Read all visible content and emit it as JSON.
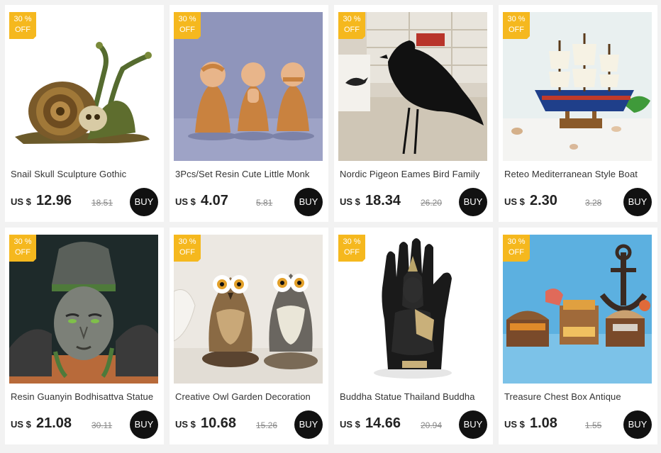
{
  "products": [
    {
      "title": "Snail Skull Sculpture Gothic",
      "currency": "US $",
      "price": "12.96",
      "old_price": "18.51",
      "discount_top": "30 %",
      "discount_bottom": "OFF",
      "buy_label": "BUY",
      "image_icon": "snail-skull-sculpture-icon"
    },
    {
      "title": "3Pcs/Set Resin Cute Little Monk",
      "currency": "US $",
      "price": "4.07",
      "old_price": "5.81",
      "discount_top": "30 %",
      "discount_bottom": "OFF",
      "buy_label": "BUY",
      "image_icon": "monk-figurines-icon"
    },
    {
      "title": "Nordic Pigeon Eames Bird Family",
      "currency": "US $",
      "price": "18.34",
      "old_price": "26.20",
      "discount_top": "30 %",
      "discount_bottom": "OFF",
      "buy_label": "BUY",
      "image_icon": "black-bird-figurine-icon"
    },
    {
      "title": "Reteo Mediterranean Style  Boat",
      "currency": "US $",
      "price": "2.30",
      "old_price": "3.28",
      "discount_top": "30 %",
      "discount_bottom": "OFF",
      "buy_label": "BUY",
      "image_icon": "sailing-ship-model-icon"
    },
    {
      "title": "Resin Guanyin Bodhisattva Statue",
      "currency": "US $",
      "price": "21.08",
      "old_price": "30.11",
      "discount_top": "30 %",
      "discount_bottom": "OFF",
      "buy_label": "BUY",
      "image_icon": "bodhisattva-head-statue-icon"
    },
    {
      "title": "Creative Owl Garden Decoration",
      "currency": "US $",
      "price": "10.68",
      "old_price": "15.26",
      "discount_top": "30 %",
      "discount_bottom": "OFF",
      "buy_label": "BUY",
      "image_icon": "owl-statues-icon"
    },
    {
      "title": "Buddha Statue Thailand Buddha",
      "currency": "US $",
      "price": "14.66",
      "old_price": "20.94",
      "discount_top": "30 %",
      "discount_bottom": "OFF",
      "buy_label": "BUY",
      "image_icon": "buddha-hand-statue-icon"
    },
    {
      "title": "Treasure Chest Box Antique",
      "currency": "US $",
      "price": "1.08",
      "old_price": "1.55",
      "discount_top": "30 %",
      "discount_bottom": "OFF",
      "buy_label": "BUY",
      "image_icon": "treasure-chest-miniature-icon"
    }
  ],
  "colors": {
    "badge": "#f5b81e",
    "buy": "#111111",
    "card": "#ffffff",
    "background": "#f2f2f2"
  }
}
